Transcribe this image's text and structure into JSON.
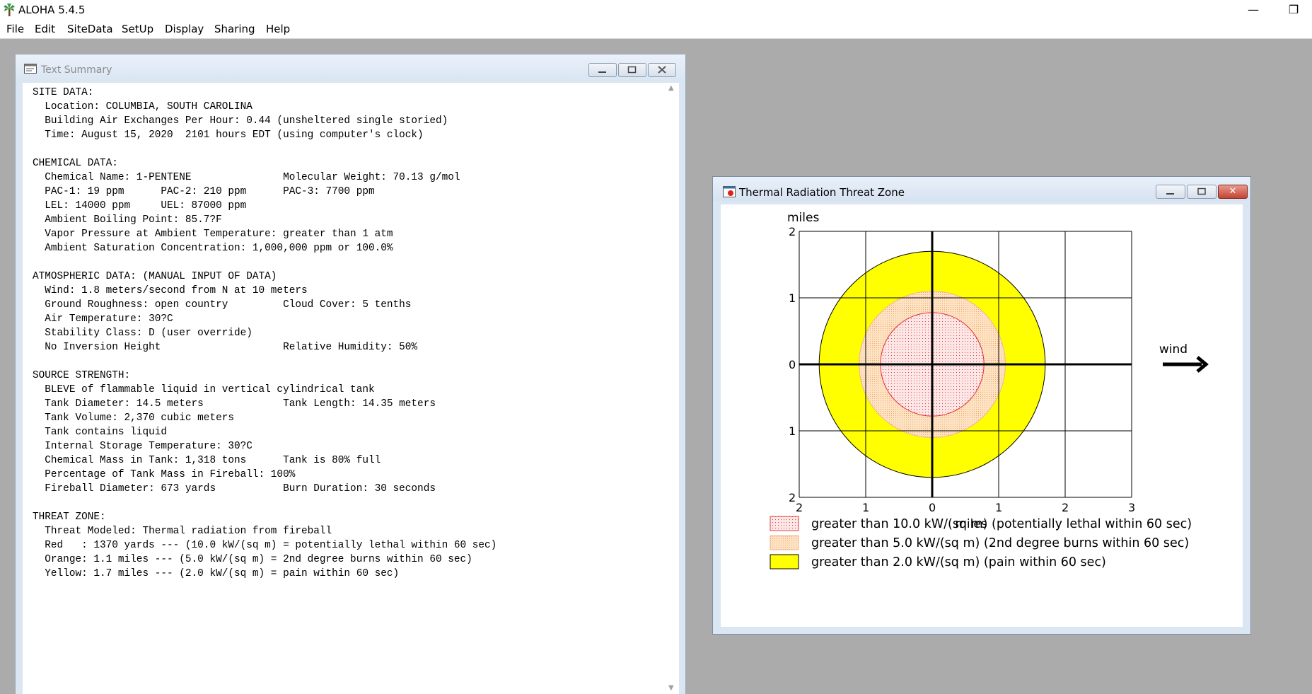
{
  "app": {
    "title": "ALOHA 5.4.5",
    "menu": [
      "File",
      "Edit",
      "SiteData",
      "SetUp",
      "Display",
      "Sharing",
      "Help"
    ],
    "controls": {
      "minimize": "—",
      "restore": "❐"
    }
  },
  "summary_window": {
    "title": "Text Summary",
    "lines": [
      "SITE DATA:",
      "  Location: COLUMBIA, SOUTH CAROLINA",
      "  Building Air Exchanges Per Hour: 0.44 (unsheltered single storied)",
      "  Time: August 15, 2020  2101 hours EDT (using computer's clock)",
      "",
      "CHEMICAL DATA:",
      "  Chemical Name: 1-PENTENE               Molecular Weight: 70.13 g/mol",
      "  PAC-1: 19 ppm      PAC-2: 210 ppm      PAC-3: 7700 ppm",
      "  LEL: 14000 ppm     UEL: 87000 ppm",
      "  Ambient Boiling Point: 85.7?F",
      "  Vapor Pressure at Ambient Temperature: greater than 1 atm",
      "  Ambient Saturation Concentration: 1,000,000 ppm or 100.0%",
      "",
      "ATMOSPHERIC DATA: (MANUAL INPUT OF DATA)",
      "  Wind: 1.8 meters/second from N at 10 meters",
      "  Ground Roughness: open country         Cloud Cover: 5 tenths",
      "  Air Temperature: 30?C",
      "  Stability Class: D (user override)",
      "  No Inversion Height                    Relative Humidity: 50%",
      "",
      "SOURCE STRENGTH:",
      "  BLEVE of flammable liquid in vertical cylindrical tank",
      "  Tank Diameter: 14.5 meters             Tank Length: 14.35 meters",
      "  Tank Volume: 2,370 cubic meters",
      "  Tank contains liquid",
      "  Internal Storage Temperature: 30?C",
      "  Chemical Mass in Tank: 1,318 tons      Tank is 80% full",
      "  Percentage of Tank Mass in Fireball: 100%",
      "  Fireball Diameter: 673 yards           Burn Duration: 30 seconds",
      "",
      "THREAT ZONE:",
      "  Threat Modeled: Thermal radiation from fireball",
      "  Red   : 1370 yards --- (10.0 kW/(sq m) = potentially lethal within 60 sec)",
      "  Orange: 1.1 miles --- (5.0 kW/(sq m) = 2nd degree burns within 60 sec)",
      "  Yellow: 1.7 miles --- (2.0 kW/(sq m) = pain within 60 sec)"
    ]
  },
  "threat_window": {
    "title": "Thermal Radiation Threat Zone",
    "close_label": "✕"
  },
  "chart_data": {
    "type": "threat-zone-plot",
    "ylabel": "miles",
    "xlabel": "miles",
    "y_ticks": [
      "2",
      "1",
      "0",
      "1",
      "2"
    ],
    "x_ticks": [
      "2",
      "1",
      "0",
      "1",
      "2",
      "3"
    ],
    "xlim": [
      -2,
      3
    ],
    "ylim": [
      -2,
      2
    ],
    "grid": true,
    "wind_label": "wind",
    "wind_direction": "right",
    "zones": [
      {
        "color": "#ffff00",
        "radius_miles": 1.7,
        "label": "greater than 2.0 kW/(sq m) (pain within 60 sec)"
      },
      {
        "color": "#fde0c0",
        "radius_miles": 1.1,
        "label": "greater than 5.0 kW/(sq m) (2nd degree burns within 60 sec)"
      },
      {
        "color": "#fde6e6",
        "radius_miles": 0.7784,
        "label": "greater than 10.0 kW/(sq m) (potentially lethal within 60 sec)"
      }
    ],
    "legend": [
      {
        "color": "#fde6e6",
        "border": "#e04040",
        "label": "greater than 10.0 kW/(sq m) (potentially lethal within 60 sec)"
      },
      {
        "color": "#fde0c0",
        "border": "#f2b48a",
        "label": "greater than 5.0 kW/(sq m) (2nd degree burns within 60 sec)"
      },
      {
        "color": "#ffff00",
        "border": "#000000",
        "label": "greater than 2.0 kW/(sq m) (pain within 60 sec)"
      }
    ]
  }
}
